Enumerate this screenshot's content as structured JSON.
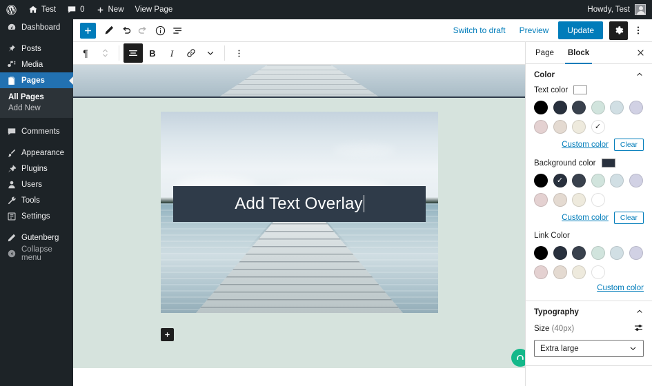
{
  "adminbar": {
    "logo_icon": "wordpress-logo-icon",
    "site_icon": "home-icon",
    "site_name": "Test",
    "comments_icon": "comment-bubble-icon",
    "comments_count": "0",
    "new_icon": "plus-icon",
    "new_label": "New",
    "view_page_label": "View Page",
    "howdy": "Howdy, Test"
  },
  "sidebar": {
    "items": [
      {
        "label": "Dashboard",
        "icon": "dashboard-icon"
      },
      {
        "label": "Posts",
        "icon": "pin-icon"
      },
      {
        "label": "Media",
        "icon": "media-icon"
      },
      {
        "label": "Pages",
        "icon": "pages-icon"
      },
      {
        "label": "Comments",
        "icon": "comment-bubble-icon"
      },
      {
        "label": "Appearance",
        "icon": "paintbrush-icon"
      },
      {
        "label": "Plugins",
        "icon": "plug-icon"
      },
      {
        "label": "Users",
        "icon": "users-icon"
      },
      {
        "label": "Tools",
        "icon": "wrench-icon"
      },
      {
        "label": "Settings",
        "icon": "settings-sliders-icon"
      },
      {
        "label": "Gutenberg",
        "icon": "pencil-icon"
      },
      {
        "label": "Collapse menu",
        "icon": "collapse-arrow-icon"
      }
    ],
    "submenu": [
      {
        "label": "All Pages",
        "current": true
      },
      {
        "label": "Add New",
        "current": false
      }
    ]
  },
  "editor_header": {
    "inserter_icon": "plus-icon",
    "tools_icon": "pencil-icon",
    "undo_icon": "undo-arrow-icon",
    "redo_icon": "redo-arrow-icon",
    "info_icon": "info-circle-icon",
    "list_view_icon": "list-view-icon",
    "switch_to_draft": "Switch to draft",
    "preview": "Preview",
    "update": "Update",
    "settings_icon": "gear-icon",
    "options_icon": "kebab-menu-icon"
  },
  "block_toolbar": {
    "block_type_icon": "paragraph-icon",
    "mover_icon": "up-down-chevrons-icon",
    "align_icon": "align-center-icon",
    "bold_label": "B",
    "italic_label": "I",
    "link_icon": "link-icon",
    "more_rich_text_icon": "chevron-down-icon",
    "options_icon": "kebab-menu-icon"
  },
  "canvas": {
    "background_color": "#d6e3dd",
    "overlay_text": "Add Text Overlay",
    "inserter_icon": "plus-icon",
    "fab_icon": "green-circle-icon"
  },
  "right_sidebar": {
    "tabs": [
      {
        "label": "Page",
        "active": false
      },
      {
        "label": "Block",
        "active": true
      }
    ],
    "close_icon": "close-icon",
    "color_panel": {
      "title": "Color",
      "collapse_icon": "chevron-up-icon",
      "text_color": {
        "label": "Text color",
        "current": "#ffffff",
        "swatches": [
          {
            "hex": "#000000",
            "selected": false
          },
          {
            "hex": "#28303d",
            "selected": false
          },
          {
            "hex": "#39414d",
            "selected": false
          },
          {
            "hex": "#d1e4dd",
            "selected": false
          },
          {
            "hex": "#d1dfe4",
            "selected": false
          },
          {
            "hex": "#d1d1e4",
            "selected": false
          },
          {
            "hex": "#e4d1d1",
            "selected": false
          },
          {
            "hex": "#e4dad1",
            "selected": false
          },
          {
            "hex": "#eeeadd",
            "selected": false
          },
          {
            "hex": "#ffffff",
            "selected": true
          }
        ],
        "custom_color": "Custom color",
        "clear": "Clear"
      },
      "background_color": {
        "label": "Background color",
        "current": "#28303d",
        "swatches": [
          {
            "hex": "#000000",
            "selected": false
          },
          {
            "hex": "#28303d",
            "selected": true
          },
          {
            "hex": "#39414d",
            "selected": false
          },
          {
            "hex": "#d1e4dd",
            "selected": false
          },
          {
            "hex": "#d1dfe4",
            "selected": false
          },
          {
            "hex": "#d1d1e4",
            "selected": false
          },
          {
            "hex": "#e4d1d1",
            "selected": false
          },
          {
            "hex": "#e4dad1",
            "selected": false
          },
          {
            "hex": "#eeeadd",
            "selected": false
          },
          {
            "hex": "#ffffff",
            "selected": false
          }
        ],
        "custom_color": "Custom color",
        "clear": "Clear"
      },
      "link_color": {
        "label": "Link Color",
        "swatches": [
          {
            "hex": "#000000",
            "selected": false
          },
          {
            "hex": "#28303d",
            "selected": false
          },
          {
            "hex": "#39414d",
            "selected": false
          },
          {
            "hex": "#d1e4dd",
            "selected": false
          },
          {
            "hex": "#d1dfe4",
            "selected": false
          },
          {
            "hex": "#d1d1e4",
            "selected": false
          },
          {
            "hex": "#e4d1d1",
            "selected": false
          },
          {
            "hex": "#e4dad1",
            "selected": false
          },
          {
            "hex": "#eeeadd",
            "selected": false
          },
          {
            "hex": "#ffffff",
            "selected": false
          }
        ],
        "custom_color": "Custom color"
      }
    },
    "typography_panel": {
      "title": "Typography",
      "collapse_icon": "chevron-up-icon",
      "size_label": "Size",
      "size_value": "(40px)",
      "controls_icon": "settings-sliders-icon",
      "size_select_value": "Extra large",
      "select_chevron_icon": "chevron-down-icon"
    }
  }
}
